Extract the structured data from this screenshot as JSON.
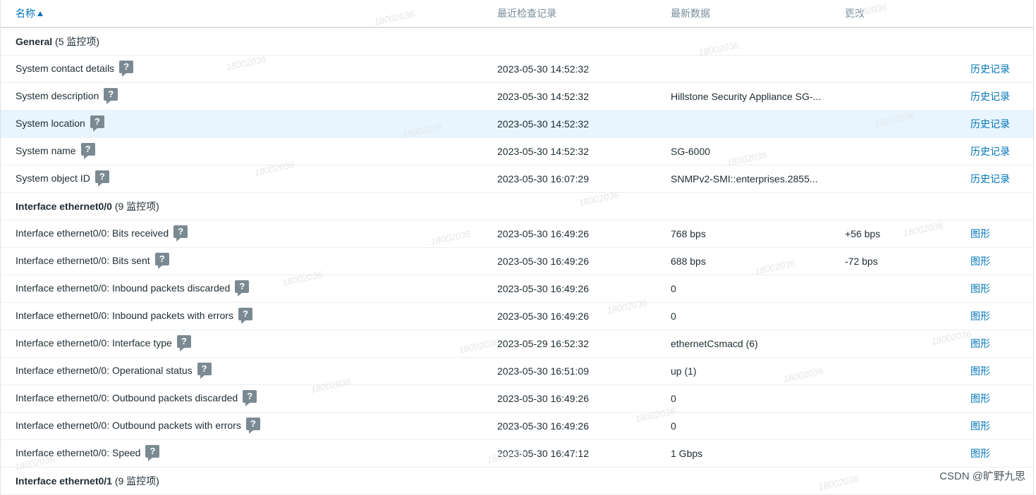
{
  "header": {
    "name": "名称",
    "last_check": "最近检查记录",
    "latest_data": "最新数据",
    "change": "更改"
  },
  "groups": [
    {
      "title": "General",
      "count": "(5 监控项)"
    },
    {
      "title": "Interface ethernet0/0",
      "count": "(9 监控项)"
    },
    {
      "title": "Interface ethernet0/1",
      "count": "(9 监控项)"
    }
  ],
  "rows": [
    {
      "name": "System contact details",
      "time": "2023-05-30 14:52:32",
      "data": "",
      "change": "",
      "link": "历史记录"
    },
    {
      "name": "System description",
      "time": "2023-05-30 14:52:32",
      "data": "Hillstone Security Appliance SG-...",
      "change": "",
      "link": "历史记录"
    },
    {
      "name": "System location",
      "time": "2023-05-30 14:52:32",
      "data": "",
      "change": "",
      "link": "历史记录"
    },
    {
      "name": "System name",
      "time": "2023-05-30 14:52:32",
      "data": "SG-6000",
      "change": "",
      "link": "历史记录"
    },
    {
      "name": "System object ID",
      "time": "2023-05-30 16:07:29",
      "data": "SNMPv2-SMI::enterprises.2855...",
      "change": "",
      "link": "历史记录"
    },
    {
      "name": "Interface ethernet0/0: Bits received",
      "time": "2023-05-30 16:49:26",
      "data": "768 bps",
      "change": "+56 bps",
      "link": "图形"
    },
    {
      "name": "Interface ethernet0/0: Bits sent",
      "time": "2023-05-30 16:49:26",
      "data": "688 bps",
      "change": "-72 bps",
      "link": "图形"
    },
    {
      "name": "Interface ethernet0/0: Inbound packets discarded",
      "time": "2023-05-30 16:49:26",
      "data": "0",
      "change": "",
      "link": "图形"
    },
    {
      "name": "Interface ethernet0/0: Inbound packets with errors",
      "time": "2023-05-30 16:49:26",
      "data": "0",
      "change": "",
      "link": "图形"
    },
    {
      "name": "Interface ethernet0/0: Interface type",
      "time": "2023-05-29 16:52:32",
      "data": "ethernetCsmacd (6)",
      "change": "",
      "link": "图形"
    },
    {
      "name": "Interface ethernet0/0: Operational status",
      "time": "2023-05-30 16:51:09",
      "data": "up (1)",
      "change": "",
      "link": "图形"
    },
    {
      "name": "Interface ethernet0/0: Outbound packets discarded",
      "time": "2023-05-30 16:49:26",
      "data": "0",
      "change": "",
      "link": "图形"
    },
    {
      "name": "Interface ethernet0/0: Outbound packets with errors",
      "time": "2023-05-30 16:49:26",
      "data": "0",
      "change": "",
      "link": "图形"
    },
    {
      "name": "Interface ethernet0/0: Speed",
      "time": "2023-05-30 16:47:12",
      "data": "1 Gbps",
      "change": "",
      "link": "图形"
    }
  ],
  "help_icon_glyph": "?",
  "watermark_text": "18002036",
  "footer_credit": "CSDN @旷野九思",
  "colors": {
    "link": "#0275b8",
    "highlight_row": "#e8f5ff",
    "help_icon_bg": "#7b8a92"
  }
}
